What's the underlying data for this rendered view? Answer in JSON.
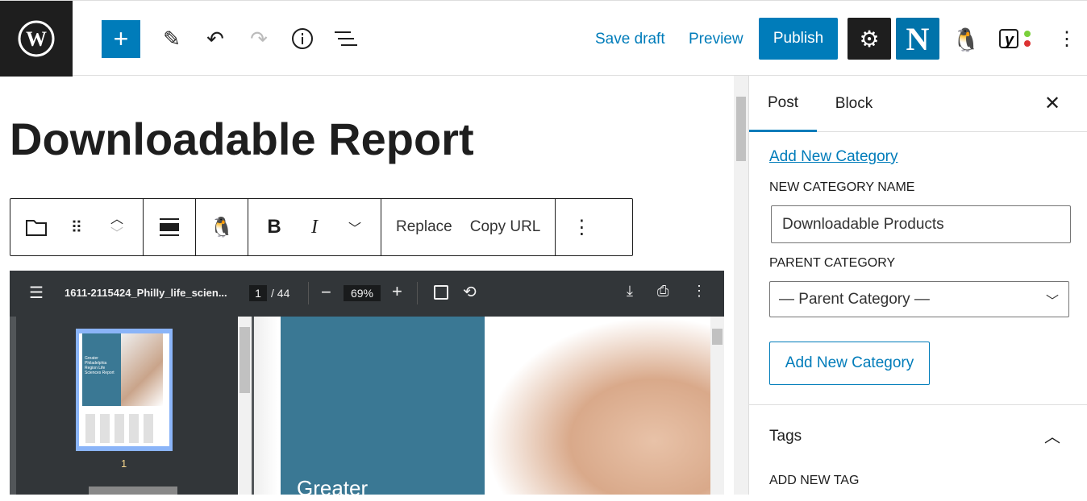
{
  "topbar": {
    "save_draft": "Save draft",
    "preview": "Preview",
    "publish": "Publish",
    "icons": [
      "wordpress-logo",
      "plus-icon",
      "pencil-icon",
      "undo-icon",
      "redo-icon",
      "info-icon",
      "list-view-icon",
      "gear-icon",
      "newspack-n-icon",
      "plugin-mascot-icon",
      "yoast-icon",
      "more-vertical-icon"
    ]
  },
  "editor": {
    "title": "Downloadable Report",
    "block_toolbar": {
      "replace": "Replace",
      "copy_url": "Copy URL",
      "bold": "B",
      "italic": "I"
    }
  },
  "pdf": {
    "filename": "1611-2115424_Philly_life_scien...",
    "page": "1",
    "total": "/ 44",
    "zoom": "69%",
    "thumb_page": "1",
    "thumb_cover_text": "Greater Philadelphia Region Life Sciences Report",
    "page_heading": "Greater"
  },
  "sidebar": {
    "tabs": [
      {
        "label": "Post",
        "active": true
      },
      {
        "label": "Block",
        "active": false
      }
    ],
    "add_new_category_link": "Add New Category",
    "new_category_label": "NEW CATEGORY NAME",
    "new_category_value": "Downloadable Products",
    "parent_label": "PARENT CATEGORY",
    "parent_value": "— Parent Category —",
    "add_button": "Add New Category",
    "tags_title": "Tags",
    "add_tag_label": "ADD NEW TAG"
  },
  "colors": {
    "accent": "#007cba",
    "dark": "#1e1e1e",
    "pdf_toolbar": "#323639",
    "cover_teal": "#3a7894"
  }
}
